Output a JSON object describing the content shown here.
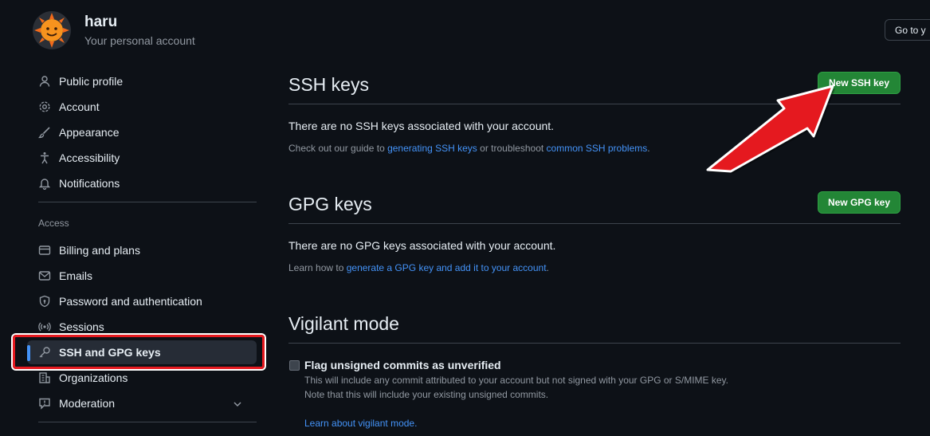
{
  "header": {
    "username": "haru",
    "account_subtitle": "Your personal account",
    "goto_button": "Go to y"
  },
  "sidebar": {
    "items": [
      {
        "label": "Public profile",
        "icon": "person-icon"
      },
      {
        "label": "Account",
        "icon": "gear-icon"
      },
      {
        "label": "Appearance",
        "icon": "paintbrush-icon"
      },
      {
        "label": "Accessibility",
        "icon": "accessibility-icon"
      },
      {
        "label": "Notifications",
        "icon": "bell-icon"
      }
    ],
    "access_section_label": "Access",
    "access_items": [
      {
        "label": "Billing and plans",
        "icon": "credit-card-icon"
      },
      {
        "label": "Emails",
        "icon": "mail-icon"
      },
      {
        "label": "Password and authentication",
        "icon": "shield-lock-icon"
      },
      {
        "label": "Sessions",
        "icon": "broadcast-icon"
      },
      {
        "label": "SSH and GPG keys",
        "icon": "key-icon",
        "active": true
      },
      {
        "label": "Organizations",
        "icon": "organization-icon"
      },
      {
        "label": "Moderation",
        "icon": "report-icon"
      }
    ]
  },
  "ssh": {
    "heading": "SSH keys",
    "new_button": "New SSH key",
    "empty_text": "There are no SSH keys associated with your account.",
    "guide_prefix": "Check out our guide to ",
    "guide_link": "generating SSH keys",
    "guide_mid": " or troubleshoot ",
    "guide_link2": "common SSH problems",
    "guide_suffix": "."
  },
  "gpg": {
    "heading": "GPG keys",
    "new_button": "New GPG key",
    "empty_text": "There are no GPG keys associated with your account.",
    "learn_prefix": "Learn how to ",
    "learn_link": "generate a GPG key and add it to your account",
    "learn_suffix": "."
  },
  "vigilant": {
    "heading": "Vigilant mode",
    "checkbox_label": "Flag unsigned commits as unverified",
    "note_line1": "This will include any commit attributed to your account but not signed with your GPG or S/MIME key.",
    "note_line2": "Note that this will include your existing unsigned commits.",
    "learn_link": "Learn about vigilant mode."
  },
  "colors": {
    "background": "#0d1117",
    "accent_green": "#238636",
    "link_blue": "#4493f8",
    "annotation_red": "#e5191f"
  }
}
